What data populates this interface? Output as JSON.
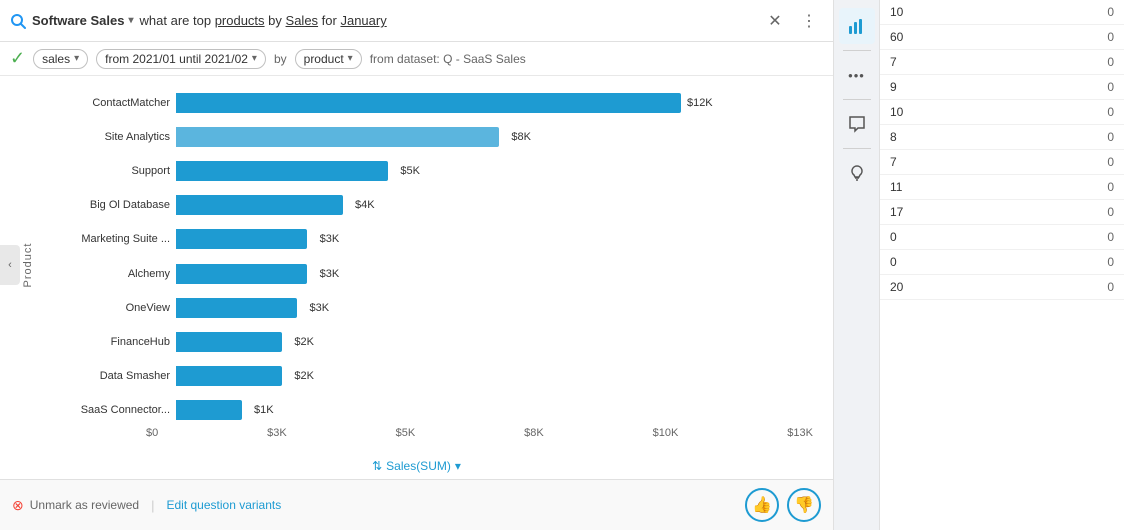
{
  "app": {
    "name": "Software Sales",
    "chevron": "▾"
  },
  "search": {
    "query_parts": [
      {
        "text": "what are top ",
        "style": "normal"
      },
      {
        "text": "products",
        "style": "underline"
      },
      {
        "text": " by ",
        "style": "normal"
      },
      {
        "text": "Sales",
        "style": "underline"
      },
      {
        "text": " for ",
        "style": "normal"
      },
      {
        "text": "January",
        "style": "underline"
      }
    ]
  },
  "filters": {
    "check": "✓",
    "chips": [
      {
        "label": "sales",
        "chevron": "▾"
      },
      {
        "label": "from 2021/01 until 2021/02",
        "chevron": "▾"
      },
      {
        "label": "product",
        "chevron": "▾"
      }
    ],
    "dataset_text": "from dataset: Q - SaaS Sales"
  },
  "chart": {
    "y_axis_label": "Product",
    "sort_label": "Sales(SUM)",
    "sort_icon": "⇅",
    "sort_chevron": "▾",
    "bars": [
      {
        "label": "ContactMatcher",
        "value": "$12K",
        "pct": 100
      },
      {
        "label": "Site Analytics",
        "value": "$8K",
        "pct": 64,
        "highlight": true
      },
      {
        "label": "Support",
        "value": "$5K",
        "pct": 42
      },
      {
        "label": "Big Ol Database",
        "value": "$4K",
        "pct": 33
      },
      {
        "label": "Marketing Suite ...",
        "value": "$3K",
        "pct": 26
      },
      {
        "label": "Alchemy",
        "value": "$3K",
        "pct": 26
      },
      {
        "label": "OneView",
        "value": "$3K",
        "pct": 24
      },
      {
        "label": "FinanceHub",
        "value": "$2K",
        "pct": 21
      },
      {
        "label": "Data Smasher",
        "value": "$2K",
        "pct": 21
      },
      {
        "label": "SaaS Connector...",
        "value": "$1K",
        "pct": 13
      }
    ],
    "x_axis": [
      "$0",
      "$3K",
      "$5K",
      "$8K",
      "$10K",
      "$13K"
    ]
  },
  "footer": {
    "unmark_icon": "⊗",
    "unmark_label": "Unmark as reviewed",
    "edit_label": "Edit question variants",
    "thumbs_up": "👍",
    "thumbs_down": "👎"
  },
  "right_panel": {
    "sidebar_icons": [
      {
        "name": "bar-chart-icon",
        "symbol": "▦",
        "active": true
      },
      {
        "name": "more-icon",
        "symbol": "•••"
      },
      {
        "name": "comment-icon",
        "symbol": "💬"
      },
      {
        "name": "lightbulb-icon",
        "symbol": "💡"
      }
    ],
    "table_rows": [
      {
        "col1": "10",
        "col2": "0"
      },
      {
        "col1": "60",
        "col2": "0"
      },
      {
        "col1": "7",
        "col2": "0"
      },
      {
        "col1": "9",
        "col2": "0"
      },
      {
        "col1": "10",
        "col2": "0"
      },
      {
        "col1": "8",
        "col2": "0"
      },
      {
        "col1": "7",
        "col2": "0"
      },
      {
        "col1": "11",
        "col2": "0"
      },
      {
        "col1": "17",
        "col2": "0"
      },
      {
        "col1": "0",
        "col2": "0"
      },
      {
        "col1": "0",
        "col2": "0"
      },
      {
        "col1": "20",
        "col2": "0"
      }
    ]
  }
}
